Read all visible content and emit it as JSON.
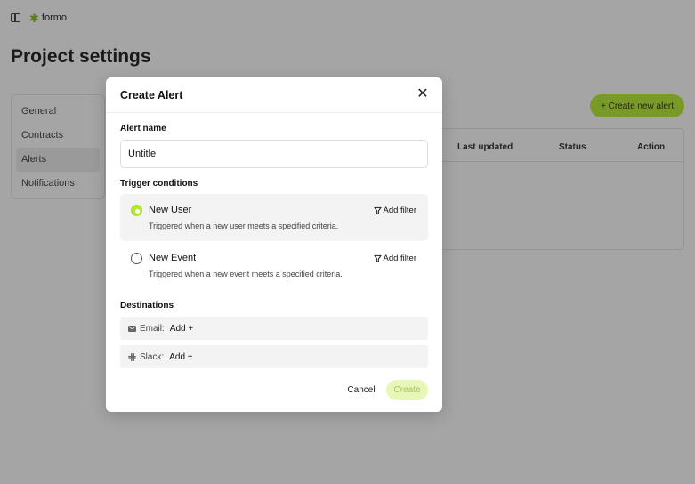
{
  "app": {
    "logo_text": "formo",
    "logo_icon": "asterisk-logo-icon",
    "brand_color": "#b3ea2a"
  },
  "page": {
    "title": "Project settings"
  },
  "settings_nav": {
    "items": [
      {
        "label": "General",
        "active": false
      },
      {
        "label": "Contracts",
        "active": false
      },
      {
        "label": "Alerts",
        "active": true
      },
      {
        "label": "Notifications",
        "active": false
      }
    ]
  },
  "alerts_panel": {
    "create_button_label": "+  Create new alert",
    "columns": [
      "Last updated",
      "Status",
      "Action"
    ]
  },
  "modal": {
    "title": "Create Alert",
    "alert_name": {
      "label": "Alert name",
      "value": "Untitle"
    },
    "trigger_conditions": {
      "label": "Trigger conditions",
      "options": [
        {
          "title": "New User",
          "description": "Triggered when a new user meets a specified criteria.",
          "selected": true,
          "filter_label": "Add filter"
        },
        {
          "title": "New Event",
          "description": "Triggered when a new event meets a specified criteria.",
          "selected": false,
          "filter_label": "Add filter"
        }
      ]
    },
    "destinations": {
      "label": "Destinations",
      "items": [
        {
          "name": "Email:",
          "icon": "mail-icon",
          "add_label": "Add +"
        },
        {
          "name": "Slack:",
          "icon": "slack-icon",
          "add_label": "Add +"
        }
      ]
    },
    "cancel_label": "Cancel",
    "create_label": "Create"
  }
}
